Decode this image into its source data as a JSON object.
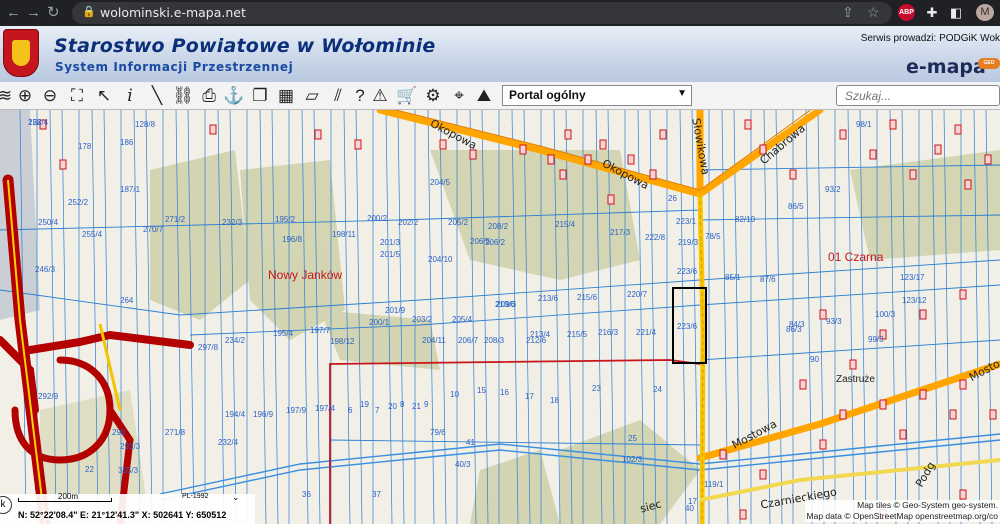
{
  "browser": {
    "url": "wolominski.e-mapa.net",
    "avatar_letter": "M",
    "abp_label": "ABP",
    "icons": [
      "back-arrow-icon",
      "forward-arrow-icon",
      "reload-icon",
      "lock-icon",
      "share-icon",
      "star-icon",
      "puzzle-icon",
      "sidebar-icon",
      "menu-icon"
    ]
  },
  "header": {
    "title": "Starostwo Powiatowe w Wołominie",
    "subtitle": "System Informacji Przestrzennej",
    "operator": "Serwis prowadzi:  PODGiK Wok",
    "logo": "e-mapa",
    "logo_badge": "GEO",
    "colors": {
      "title": "#0c2f7a",
      "subtitle": "#1a4aa3",
      "banner": "#c9d6e8"
    }
  },
  "toolbar": {
    "tools": [
      "pan-icon",
      "zoom-in-icon",
      "zoom-out-icon",
      "zoom-extent-icon",
      "select-arrow-icon",
      "info-icon",
      "measure-icon",
      "link-icon",
      "print-icon",
      "anchor-icon",
      "layers-copy-icon",
      "layout-icon",
      "shape-icon",
      "hatch-icon",
      "help-icon",
      "warning-layers-icon",
      "cart-icon",
      "settings-icon",
      "location-icon",
      "terrain-icon"
    ],
    "portal_select": "Portal ogólny",
    "search_placeholder": "Szukaj..."
  },
  "map": {
    "places": {
      "nowy_jankow": "Nowy Janków",
      "czarna": "01 Czarna",
      "zastruze": "Zastruże"
    },
    "streets": {
      "okopowa_1": "Okopowa",
      "okopowa_2": "Okopowa",
      "slowikowa": "Słowikowa",
      "chabrowa": "Chabrowa",
      "mostowa_1": "Mostowa",
      "mostowa_2": "Mosto",
      "czarnieckiego": "Czarnieckiego",
      "podg": "Podg",
      "sieci": "siec"
    },
    "parcels": [
      "258/4",
      "128/8",
      "186",
      "178",
      "187/1",
      "252/2",
      "271/2",
      "270/7",
      "255/4",
      "246/3",
      "264",
      "250/4",
      "232/3",
      "195/2",
      "196/8",
      "198/11",
      "202/2",
      "200/2",
      "201/3",
      "201/5",
      "204/5",
      "204/10",
      "205/2",
      "208/2",
      "206/5",
      "206/2",
      "215/4",
      "217/3",
      "222/8",
      "223/1",
      "219/3",
      "223/6",
      "213/6",
      "215/6",
      "220/7",
      "213/6",
      "209/3",
      "205/4",
      "201/9",
      "200/1",
      "203/2",
      "204/11",
      "206/7",
      "208/3",
      "212/6",
      "213/4",
      "215/5",
      "216/3",
      "221/4",
      "223/6",
      "195/4",
      "197/7",
      "198/12",
      "234/2",
      "297/8",
      "26",
      "82/10",
      "78/5",
      "86/5",
      "93/2",
      "86/3",
      "100/3",
      "123/17",
      "85/1",
      "87/6",
      "84/3",
      "93/3",
      "99/3",
      "98/1",
      "123/12",
      "90",
      "23",
      "24",
      "25",
      "41",
      "37",
      "36",
      "40/3",
      "102/3",
      "119/1",
      "271/8",
      "194/4",
      "196/9",
      "197/9",
      "197/4",
      "232/4",
      "6",
      "7",
      "8",
      "9",
      "10",
      "15",
      "16",
      "17",
      "18",
      "19",
      "20",
      "21",
      "22",
      "355/3",
      "290",
      "293/3",
      "292/9",
      "17",
      "79/6",
      "40",
      "122"
    ],
    "colors": {
      "road_orange": "#ffa500",
      "road_red": "#b30000",
      "parcel_line": "#2b7fd4",
      "label": "#2b63c8",
      "boundary": "#c8141c"
    }
  },
  "status": {
    "scale": "200m",
    "crs": "PL-1992",
    "coords": "N: 52°22'08.4\"  E: 21°12'41.3\"   X: 502641      Y: 650512",
    "attribution_1": "Map tiles © Geo-System geo-system.",
    "attribution_2": "Map data © OpenStreetMap openstreetmap.org/co",
    "k_label": "k"
  }
}
